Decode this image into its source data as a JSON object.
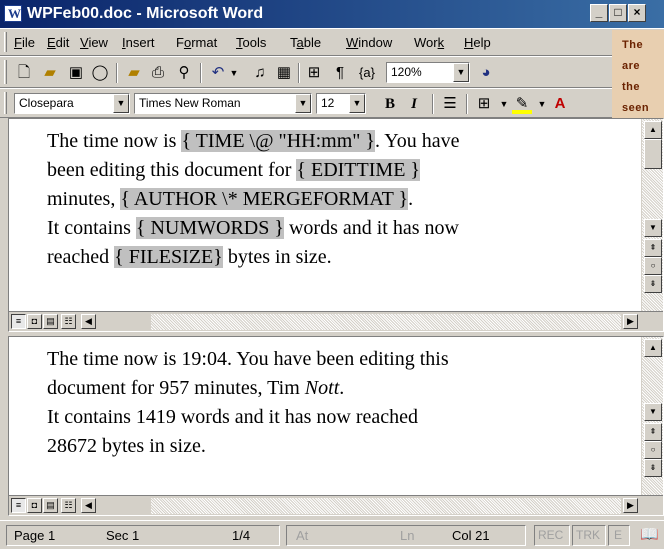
{
  "window": {
    "title": "WPFeb00.doc - Microsoft Word",
    "controls": [
      "_",
      "□",
      "×"
    ]
  },
  "menubar": {
    "items": [
      {
        "u": "F",
        "rest": "ile"
      },
      {
        "u": "E",
        "rest": "dit"
      },
      {
        "u": "V",
        "rest": "iew"
      },
      {
        "u": "I",
        "rest": "nsert"
      },
      {
        "pre": "F",
        "u": "o",
        "rest": "rmat"
      },
      {
        "u": "T",
        "rest": "ools"
      },
      {
        "pre": "T",
        "u": "a",
        "rest": "ble"
      },
      {
        "u": "W",
        "rest": "indow"
      },
      {
        "pre": "Wor",
        "u": "k",
        "rest": ""
      },
      {
        "u": "H",
        "rest": "elp"
      }
    ]
  },
  "toolbar_standard": {
    "icons": [
      "new-icon",
      "open-icon",
      "save-icon",
      "comment-icon",
      "open-folder-icon",
      "print-icon",
      "find-icon",
      "undo-icon",
      "bell-icon",
      "form-icon",
      "preview-icon",
      "pilcrow-icon",
      "field-codes-icon",
      "help-icon"
    ],
    "field_codes_label": "{a}",
    "zoom": "120%"
  },
  "toolbar_formatting": {
    "style": "Closepara",
    "font": "Times New Roman",
    "size": "12",
    "bold_label": "B",
    "italic_label": "I"
  },
  "caption": {
    "lines": [
      "The",
      "are",
      "the",
      "seen"
    ]
  },
  "pane_codes": {
    "line1": {
      "t1": "The time now is ",
      "f1": "{ TIME \\@ \"HH:mm\" }",
      "t2": ". You have"
    },
    "line2": {
      "t1": "been editing this document for ",
      "f1": "{ EDITTIME }",
      "t2": ""
    },
    "line3": {
      "t1": "minutes, ",
      "f1": "{ AUTHOR  \\* MERGEFORMAT }",
      "t2": "."
    },
    "line4": {
      "t1": "It contains ",
      "f1": "{ NUMWORDS }",
      "t2": " words and it has now"
    },
    "line5": {
      "t1": "reached ",
      "f1": "{ FILESIZE}",
      "t2": " bytes in size."
    }
  },
  "pane_results": {
    "line1": "The time now is 19:04. You have been editing this",
    "line2_pre": "document for 957 minutes, Tim ",
    "line2_italic": "Nott",
    "line2_post": ".",
    "line3": "It contains 1419 words and it has now reached",
    "line4": "28672 bytes in size."
  },
  "statusbar": {
    "page": "Page 1",
    "sec": "Sec 1",
    "pages": "1/4",
    "at": "At",
    "ln": "Ln",
    "col": "Col 21",
    "rec": "REC",
    "trk": "TRK",
    "ext": "E"
  },
  "colors": {
    "titlebar_start": "#0a246a",
    "field_shading": "#c0c0c0",
    "caption_bg": "#e8cfb0",
    "caption_text": "#6a2200"
  }
}
